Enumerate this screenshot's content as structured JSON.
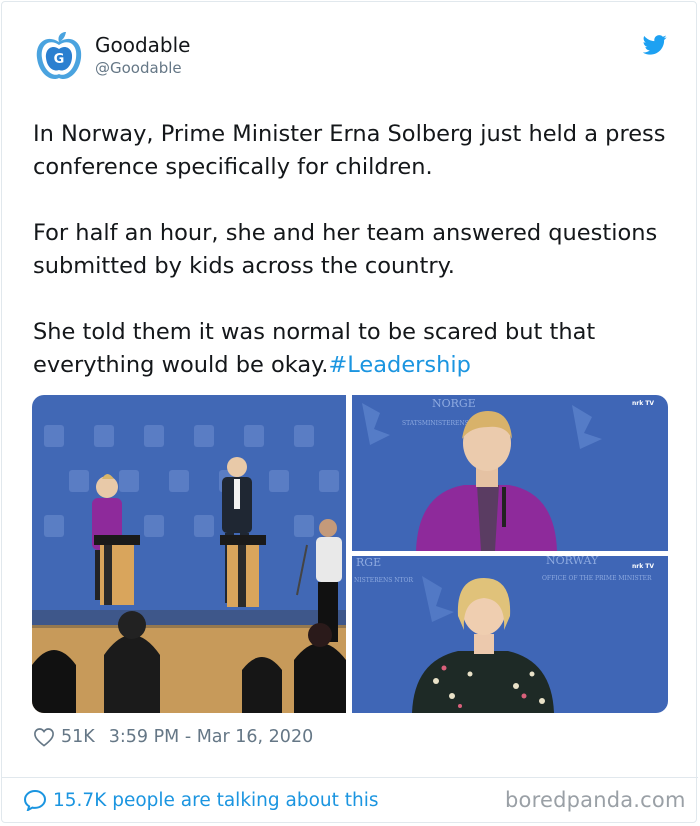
{
  "author": {
    "name": "Goodable",
    "handle": "@Goodable",
    "avatar_letter": "G"
  },
  "tweet": {
    "paragraphs": [
      "In Norway, Prime Minister Erna Solberg just held a press conference specifically for children.",
      "For half an hour, she and her team answered questions submitted by kids across the country."
    ],
    "last_paragraph_text": "She told them it was normal to be scared but that everything would be okay.",
    "hashtag": "#Leadership"
  },
  "media": {
    "top_right_backdrop_text": "NORGE",
    "top_right_sub_text": "STATSMINISTERENS KONTOR",
    "top_right_tv_logo": "nrk TV",
    "bottom_right_backdrop_text": "NORWAY",
    "bottom_right_sub_text": "OFFICE OF THE PRIME MINISTER",
    "bottom_right_left_text": "RGE",
    "bottom_right_left_sub": "NISTERENS NTOR",
    "bottom_right_tv_logo": "nrk TV"
  },
  "meta": {
    "likes": "51K",
    "timestamp": "3:59 PM - Mar 16, 2020"
  },
  "footer": {
    "talking": "15.7K people are talking about this",
    "watermark": "boredpanda.com"
  },
  "colors": {
    "link": "#1b95e0",
    "muted": "#657786",
    "backdrop_blue": "#3f66b6",
    "jacket_purple": "#8e2a9b"
  }
}
